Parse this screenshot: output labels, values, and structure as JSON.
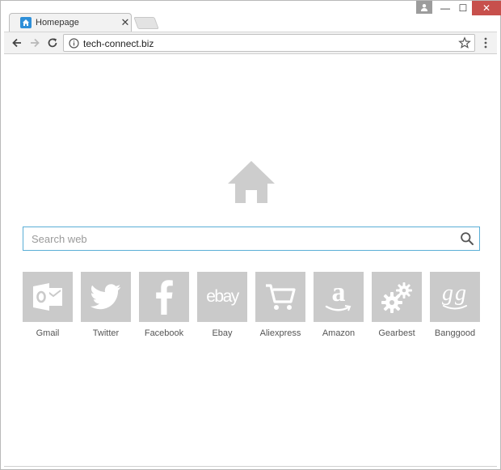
{
  "tab": {
    "title": "Homepage",
    "close_glyph": "✕"
  },
  "window_controls": {
    "minimize": "—",
    "maximize": "☐",
    "close": "✕"
  },
  "address_bar": {
    "url": "tech-connect.biz"
  },
  "search": {
    "placeholder": "Search web"
  },
  "shortcuts": [
    {
      "label": "Gmail",
      "icon": "outlook-icon"
    },
    {
      "label": "Twitter",
      "icon": "twitter-icon"
    },
    {
      "label": "Facebook",
      "icon": "facebook-icon"
    },
    {
      "label": "Ebay",
      "icon": "ebay-icon",
      "logo_text": "ebay"
    },
    {
      "label": "Aliexpress",
      "icon": "cart-icon"
    },
    {
      "label": "Amazon",
      "icon": "amazon-icon",
      "logo_text": "a"
    },
    {
      "label": "Gearbest",
      "icon": "gears-icon"
    },
    {
      "label": "Banggood",
      "icon": "banggood-icon",
      "logo_text": "gg"
    }
  ],
  "colors": {
    "tile_bg": "#cacaca",
    "search_border": "#5aaed6",
    "close_button": "#c7504c",
    "tab_favicon": "#2e8fd8"
  }
}
